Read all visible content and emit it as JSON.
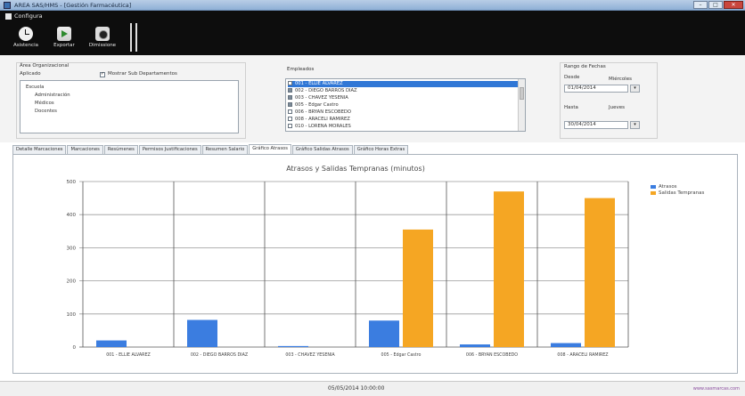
{
  "window": {
    "title": "AREA SAS/HMS - [Gestión Farmacéutica]",
    "buttons": {
      "minimize": "–",
      "maximize": "□",
      "close": "✕"
    }
  },
  "ribbon": {
    "menu_label": "Configura",
    "tools": [
      {
        "label": "Asistencia",
        "icon": "clock-icon"
      },
      {
        "label": "Exportar",
        "icon": "export-icon"
      },
      {
        "label": "Dimissione",
        "icon": "camera-icon"
      }
    ]
  },
  "filters": {
    "area_group_label": "Área Organizacional",
    "area_sublabel": "Aplicado",
    "show_sub_label": "Mostrar Sub Departamentos",
    "tree": [
      "Escuela",
      "Administración",
      "Médicos",
      "Docentes"
    ],
    "employees_label": "Empleados",
    "employees": [
      {
        "text": "001 - ELLIE ALVAREZ",
        "checked": false,
        "selected": true
      },
      {
        "text": "002 - DIEGO BARROS DIAZ",
        "checked": true,
        "selected": false
      },
      {
        "text": "003 - CHAVEZ YESENIA",
        "checked": true,
        "selected": false
      },
      {
        "text": "005 - Edgar Castro",
        "checked": true,
        "selected": false
      },
      {
        "text": "006 - BRYAN ESCOBEDO",
        "checked": false,
        "selected": false
      },
      {
        "text": "008 - ARACELI RAMIREZ",
        "checked": false,
        "selected": false
      },
      {
        "text": "010 - LORENA MORALES",
        "checked": false,
        "selected": false
      }
    ],
    "date_group_label": "Rango de Fechas",
    "from_label": "Desde",
    "from_sub": "Miércoles",
    "from_value": "01/04/2014",
    "to_label": "Hasta",
    "to_sub": "Jueves",
    "to_value": "30/04/2014"
  },
  "tabs": [
    {
      "label": "Detalle Marcaciones",
      "active": false
    },
    {
      "label": "Marcaciones",
      "active": false
    },
    {
      "label": "Resúmenes",
      "active": false
    },
    {
      "label": "Permisos Justificaciones",
      "active": false
    },
    {
      "label": "Resumen Salario",
      "active": false
    },
    {
      "label": "Gráfico Atrasos",
      "active": true
    },
    {
      "label": "Gráfico Salidas Atrasos",
      "active": false
    },
    {
      "label": "Gráfico Horas Extras",
      "active": false
    }
  ],
  "chart_data": {
    "type": "bar",
    "title": "Atrasos y Salidas Tempranas (minutos)",
    "categories": [
      "001 - ELLIE ALVAREZ",
      "002 - DIEGO BARROS DIAZ",
      "003 - CHAVEZ YESENIA",
      "005 - Edgar Castro",
      "006 - BRYAN ESCOBEDO",
      "008 - ARACELI RAMIREZ"
    ],
    "series": [
      {
        "name": "Atrasos",
        "color": "#3b7de0",
        "values": [
          20,
          82,
          3,
          80,
          8,
          12
        ]
      },
      {
        "name": "Salidas Tempranas",
        "color": "#f5a623",
        "values": [
          0,
          0,
          0,
          355,
          470,
          450
        ]
      }
    ],
    "yticks": [
      "0",
      "100",
      "200",
      "300",
      "400",
      "500"
    ],
    "ylim": [
      0,
      500
    ],
    "grid": true,
    "legend": "top-right"
  },
  "status": {
    "datetime": "05/05/2014 10:00:00",
    "brand": "www.sasmarcas.com"
  }
}
